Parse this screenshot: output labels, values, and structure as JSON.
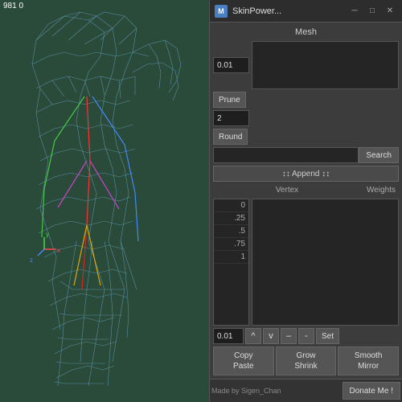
{
  "titlebar": {
    "icon": "M",
    "title": "SkinPower...",
    "minimize": "─",
    "maximize": "□",
    "close": "✕"
  },
  "panel": {
    "mesh_label": "Mesh",
    "prune_value": "0.01",
    "prune_btn": "Prune",
    "round_value": "2",
    "round_btn": "Round",
    "search_btn": "Search",
    "append_btn": "↕↕ Append ↕↕",
    "vertex_label": "Vertex",
    "weights_label": "Weights",
    "vertex_values": [
      "0",
      ".25",
      ".5",
      ".75",
      "1"
    ],
    "stepper_value": "0.01",
    "stepper_up": "^",
    "stepper_down": "v",
    "stepper_minus1": "–",
    "stepper_minus2": "-",
    "set_btn": "Set",
    "copy_btn": "Copy",
    "paste_btn": "Paste",
    "grow_btn": "Grow",
    "shrink_btn": "Shrink",
    "smooth_btn": "Smooth",
    "mirror_btn": "Mirror",
    "footer_text": "Made by Sigen_Chan",
    "donate_btn": "Donate Me !"
  },
  "viewport": {
    "info_line1": "",
    "info_line2": "981    0"
  },
  "colors": {
    "accent": "#4a7fc1",
    "bg_dark": "#2a4a3a",
    "mesh_color": "#88aacc",
    "bone_color": "#ff4444"
  }
}
